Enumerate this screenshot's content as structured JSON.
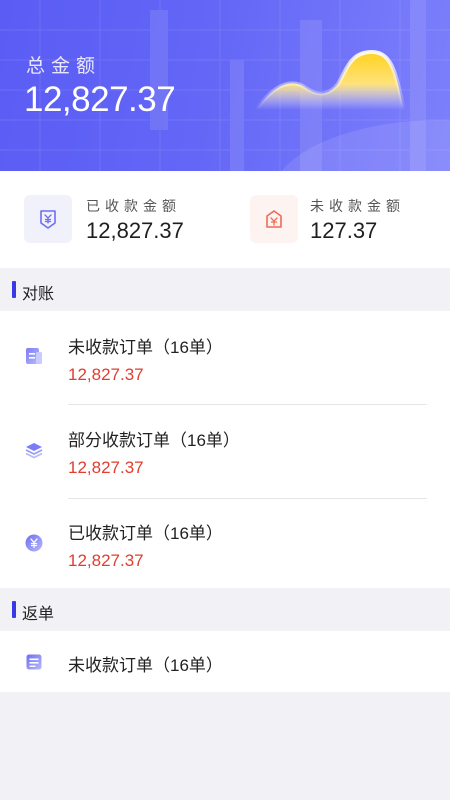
{
  "hero": {
    "label": "总金额",
    "amount": "12,827.37"
  },
  "summary": {
    "received": {
      "label": "已收款金额",
      "value": "12,827.37",
      "icon": "download-yuan-icon"
    },
    "unreceived": {
      "label": "未收款金额",
      "value": "127.37",
      "icon": "upload-yuan-icon"
    }
  },
  "reconcile": {
    "title": "对账",
    "items": [
      {
        "label": "未收款订单（16单）",
        "amount": "12,827.37",
        "icon": "document-icon"
      },
      {
        "label": "部分收款订单（16单）",
        "amount": "12,827.37",
        "icon": "layers-icon"
      },
      {
        "label": "已收款订单（16单）",
        "amount": "12,827.37",
        "icon": "yuan-coin-icon"
      }
    ]
  },
  "returns": {
    "title": "返单",
    "items": [
      {
        "label": "未收款订单（16单）",
        "icon": "list-icon"
      }
    ]
  },
  "colors": {
    "accent": "#3a39e8",
    "hero_gradient_start": "#5a5cf4",
    "amount_red": "#e23d2f"
  }
}
